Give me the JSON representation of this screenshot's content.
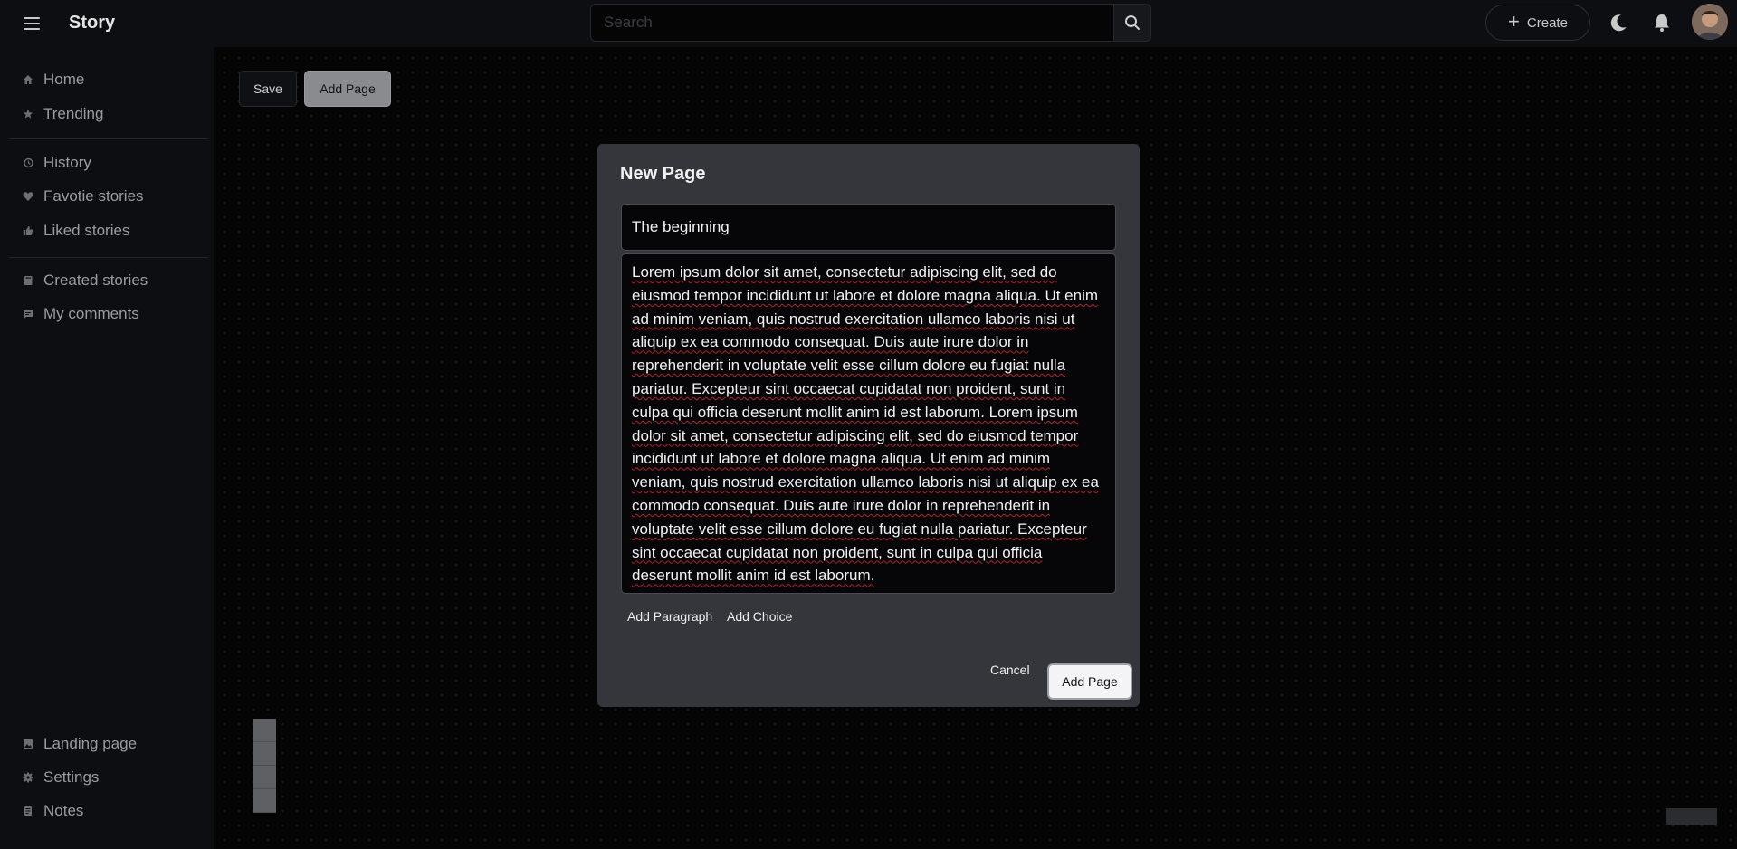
{
  "app": {
    "title": "Story"
  },
  "search": {
    "placeholder": "Search"
  },
  "header": {
    "create_label": "Create"
  },
  "sidebar": {
    "items": [
      {
        "label": "Home",
        "icon": "home-icon"
      },
      {
        "label": "Trending",
        "icon": "star-icon"
      },
      {
        "label": "History",
        "icon": "history-icon"
      },
      {
        "label": "Favotie stories",
        "icon": "heart-icon"
      },
      {
        "label": "Liked stories",
        "icon": "thumbs-up-icon"
      },
      {
        "label": "Created stories",
        "icon": "book-icon"
      },
      {
        "label": "My comments",
        "icon": "comment-icon"
      },
      {
        "label": "Landing page",
        "icon": "image-icon"
      },
      {
        "label": "Settings",
        "icon": "gear-icon"
      },
      {
        "label": "Notes",
        "icon": "note-icon"
      }
    ]
  },
  "toolbar": {
    "save_label": "Save",
    "add_page_label": "Add Page"
  },
  "dialog": {
    "title": "New Page",
    "page_title_value": "The beginning",
    "body_value": "Lorem ipsum dolor sit amet, consectetur adipiscing elit, sed do eiusmod tempor incididunt ut labore et dolore magna aliqua. Ut enim ad minim veniam, quis nostrud exercitation ullamco laboris nisi ut aliquip ex ea commodo consequat. Duis aute irure dolor in reprehenderit in voluptate velit esse cillum dolore eu fugiat nulla pariatur. Excepteur sint occaecat cupidatat non proident, sunt in culpa qui officia deserunt mollit anim id est laborum. Lorem ipsum dolor sit amet, consectetur adipiscing elit, sed do eiusmod tempor incididunt ut labore et dolore magna aliqua. Ut enim ad minim veniam, quis nostrud exercitation ullamco laboris nisi ut aliquip ex ea commodo consequat. Duis aute irure dolor in reprehenderit in voluptate velit esse cillum dolore eu fugiat nulla pariatur. Excepteur sint occaecat cupidatat non proident, sunt in culpa qui officia deserunt mollit anim id est laborum.",
    "add_paragraph_label": "Add Paragraph",
    "add_choice_label": "Add Choice",
    "cancel_label": "Cancel",
    "add_page_label": "Add Page"
  },
  "colors": {
    "background": "#0d0e11",
    "dialog": "#34363c",
    "field": "#060608",
    "primary_button": "#f4f4f6"
  }
}
